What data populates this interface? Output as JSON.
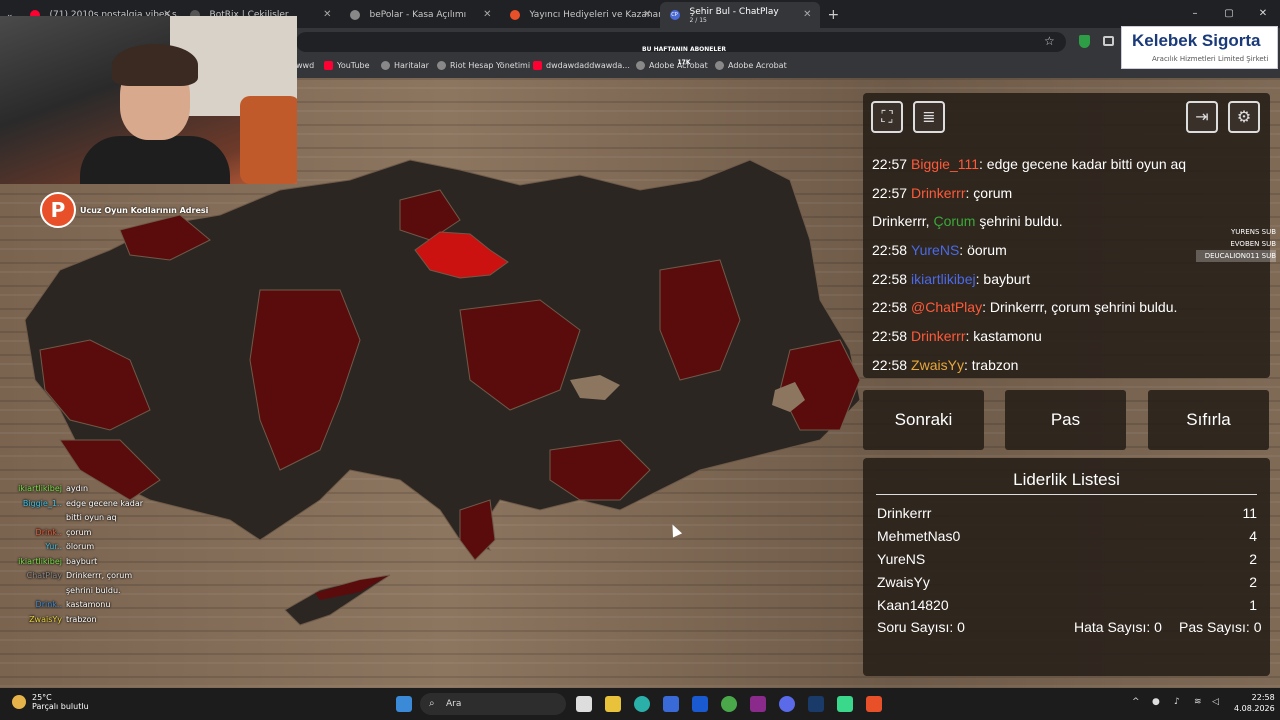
{
  "tabs": [
    {
      "title": "(71) 2010s nostalgia vibes s...",
      "color": "#ff0033"
    },
    {
      "title": "BotRix | Çekilişler",
      "color": "#222222"
    },
    {
      "title": "bePolar - Kasa Açılımı",
      "color": "#888888"
    },
    {
      "title": "Yayıncı Hediyeleri ve Kazananlar",
      "color": "#e8502a"
    },
    {
      "title": "Şehir Bul - ChatPlay",
      "color": "#4a6ad8",
      "sub": "2 / 15"
    }
  ],
  "tab_prefix_active": "CP",
  "window_controls": {
    "min": "–",
    "max": "▢",
    "close": "✕"
  },
  "new_tab": "+",
  "bookmarks": [
    {
      "label": "wwd",
      "color": "#888888"
    },
    {
      "label": "YouTube",
      "color": "#ff0033"
    },
    {
      "label": "Haritalar",
      "color": "#888888"
    },
    {
      "label": "Riot Hesap Yönetimi",
      "color": "#888888"
    },
    {
      "label": "dwdawdaddwawda...",
      "color": "#ff0033"
    },
    {
      "label": "Adobe Acrobat",
      "color": "#888888"
    },
    {
      "label": "Adobe Acrobat",
      "color": "#888888"
    }
  ],
  "weekly_title": "BU HAFTANIN ABONELER",
  "weekly_sub": "17K",
  "sponsor": {
    "brand": "Kelebek Sigorta",
    "sub": "Aracılık Hizmetleri Limited Şirketi"
  },
  "promo": {
    "logo": "P",
    "text": "Ucuz Oyun Kodlarının Adresi"
  },
  "overlay_chat": [
    {
      "user": "ikiartlikibej",
      "msg": "aydın",
      "color": "#7adf4a"
    },
    {
      "user": "Biggie_1..",
      "msg": "edge gecene kadar bitti oyun aq",
      "color": "#3ac0e8"
    },
    {
      "user": "Drink..",
      "msg": "çorum",
      "color": "#e85a3a"
    },
    {
      "user": "Yur..",
      "msg": "ölorum",
      "color": "#3ac0e8"
    },
    {
      "user": "ikiartlikibej",
      "msg": "bayburt",
      "color": "#7adf4a"
    },
    {
      "user": "ChatPlay",
      "msg": "Drinkerrr, çorum şehrini buldu.",
      "color": "#888888"
    },
    {
      "user": "Drink..",
      "msg": "kastamonu",
      "color": "#3a8ad8"
    },
    {
      "user": "ZwaisYy",
      "msg": "trabzon",
      "color": "#e8d23a"
    }
  ],
  "chat": [
    {
      "time": "22:57",
      "user": "Biggie_111",
      "color": "#ff5a3a",
      "text": ": edge gecene kadar bitti oyun aq"
    },
    {
      "time": "22:57",
      "user": "Drinkerrr",
      "color": "#ff5a3a",
      "text": ": çorum"
    },
    {
      "system": true,
      "pre": "Drinkerrr, ",
      "city": "Çorum",
      "post": " şehrini buldu."
    },
    {
      "time": "22:58",
      "user": "YureNS",
      "color": "#4a6ae8",
      "text": ": öorum"
    },
    {
      "time": "22:58",
      "user": "ikiartlikibej",
      "color": "#4a6ae8",
      "text": ": bayburt"
    },
    {
      "time": "22:58",
      "user": "@ChatPlay",
      "color": "#ff5a3a",
      "text": ": Drinkerrr, çorum şehrini buldu."
    },
    {
      "time": "22:58",
      "user": "Drinkerrr",
      "color": "#ff5a3a",
      "text": ": kastamonu"
    },
    {
      "time": "22:58",
      "user": "ZwaisYy",
      "color": "#e8a83a",
      "text": ": trabzon"
    }
  ],
  "side_subs": [
    "YURENS SUB",
    "EVOBEN SUB",
    "DEUCALION011 SUB"
  ],
  "buttons": {
    "next": "Sonraki",
    "pass": "Pas",
    "reset": "Sıfırla"
  },
  "leaderboard": {
    "title": "Liderlik Listesi",
    "rows": [
      {
        "name": "Drinkerrr",
        "score": "11"
      },
      {
        "name": "MehmetNas0",
        "score": "4"
      },
      {
        "name": "YureNS",
        "score": "2"
      },
      {
        "name": "ZwaisYy",
        "score": "2"
      },
      {
        "name": "Kaan14820",
        "score": "1"
      }
    ],
    "question_count": "Soru Sayısı: 0",
    "error_count": "Hata Sayısı: 0",
    "pass_count": "Pas Sayısı: 0"
  },
  "taskbar": {
    "temp": "25°C",
    "weather": "Parçalı bulutlu",
    "search": "Ara",
    "time": "22:58",
    "date": "4.08.2026"
  },
  "colors": {
    "found_province": "#cc1111",
    "owned": "#5a0c0c",
    "neutral": "#2c2622"
  }
}
